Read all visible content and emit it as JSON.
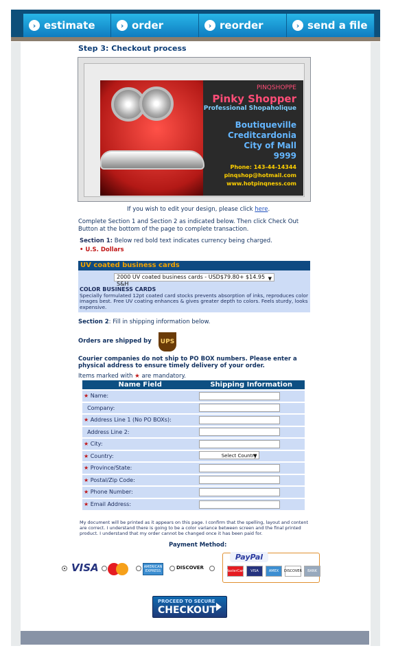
{
  "nav": {
    "tabs": [
      {
        "label": "estimate"
      },
      {
        "label": "order"
      },
      {
        "label": "reorder"
      },
      {
        "label": "send a file"
      }
    ]
  },
  "page": {
    "title": "Step 3: Checkout process"
  },
  "preview": {
    "lines": [
      "PINQSHOPPE",
      "Pinky Shopper",
      "Professional Shopaholique",
      "Boutiqueville",
      "Creditcardonia",
      "City of Mall",
      "9999",
      "Phone: 143-44-14344",
      "pinqshop@hotmail.com",
      "www.hotpinqness.com"
    ]
  },
  "edit": {
    "text": "If you wish to edit your design, please click ",
    "link": "here",
    "suffix": "."
  },
  "instructions": {
    "text": "Complete Section 1 and Section 2 as indicated below. Then click Check Out Button at the bottom of the page to complete transaction."
  },
  "section1": {
    "label": "Section 1:",
    "text": "Below red bold text indicates currency being charged.",
    "currency": "U.S. Dollars"
  },
  "product": {
    "heading": "UV coated business cards",
    "selected": "2000 UV coated business cards - USD$79.80+ $14.95 S&H",
    "desc_title": "COLOR BUSINESS CARDS",
    "desc": "Specially formulated 12pt coated card stocks prevents absorption of inks, reproduces color images best. Free UV coating enhances & gives greater depth to colors. Feels sturdy, looks expensive."
  },
  "section2": {
    "label": "Section 2",
    "text": ": Fill in shipping information below."
  },
  "shipping": {
    "label": "Orders are shipped by",
    "carrier": "UPS",
    "notice": "Courier companies do not ship to PO BOX numbers. Please enter a physical address to ensure timely delivery of your order.",
    "mandatory": "Items marked with ",
    "mandatory_suffix": " are mandatory."
  },
  "form": {
    "headers": [
      "Name Field",
      "Shipping Information"
    ],
    "rows": [
      {
        "label": "Name:",
        "required": true
      },
      {
        "label": "Company:",
        "required": false
      },
      {
        "label": "Address Line 1 (No PO BOXs):",
        "required": true
      },
      {
        "label": "Address Line 2:",
        "required": false
      },
      {
        "label": "City:",
        "required": true
      },
      {
        "label": "Country:",
        "required": true,
        "select": "Select Country"
      },
      {
        "label": "Province/State:",
        "required": true
      },
      {
        "label": "Postal/Zip Code:",
        "required": true
      },
      {
        "label": "Phone Number:",
        "required": true
      },
      {
        "label": "Email Address:",
        "required": true
      }
    ]
  },
  "disclaimer": "My document will be printed as it appears on this page. I confirm that the spelling, layout and content are correct. I understand there is going to be a color variance between screen and the final printed product. I understand that my order cannot be changed once it has been paid for.",
  "payment": {
    "label": "Payment Method:",
    "options": [
      "VISA",
      "MasterCard",
      "AMERICAN EXPRESS",
      "DISCOVER",
      "PayPal"
    ],
    "paypal_cards": [
      "MasterCard",
      "VISA",
      "AMEX",
      "DISCOVER",
      "BANK"
    ]
  },
  "checkout": {
    "small": "PROCEED TO SECURE",
    "big": "CHECKOUT"
  }
}
